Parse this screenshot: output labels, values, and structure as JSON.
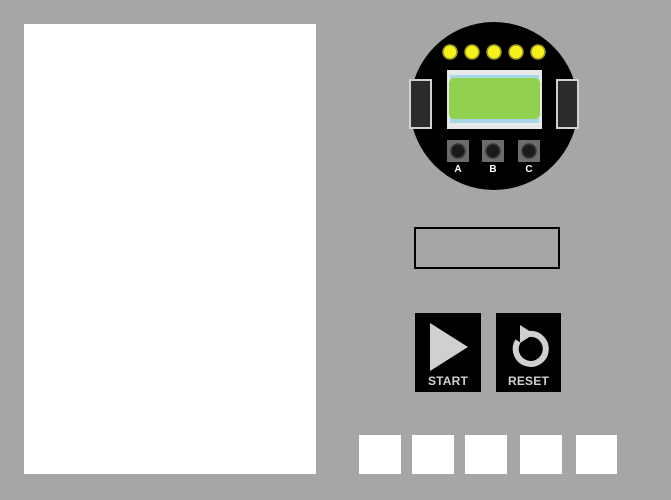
{
  "workspace": {},
  "device": {
    "led_count": 5,
    "led_color": "#f4f21a",
    "screen_color": "#92d050",
    "buttons": [
      {
        "label": "A"
      },
      {
        "label": "B"
      },
      {
        "label": "C"
      }
    ]
  },
  "display": {
    "value": ""
  },
  "controls": {
    "start_label": "START",
    "start_icon": "play-icon",
    "reset_label": "RESET",
    "reset_icon": "reset-icon"
  },
  "slots": [
    {
      "value": ""
    },
    {
      "value": ""
    },
    {
      "value": ""
    },
    {
      "value": ""
    },
    {
      "value": ""
    }
  ],
  "colors": {
    "background": "#a6a6a6",
    "panel": "#ffffff",
    "button_bg": "#000000",
    "button_fg": "#d0d0d0"
  }
}
